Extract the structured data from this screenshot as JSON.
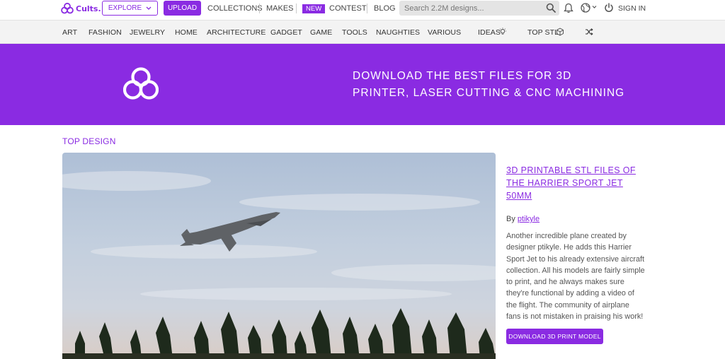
{
  "brand": {
    "name": "Cults.",
    "accent": "#8a2be2"
  },
  "topnav": {
    "explore_label": "EXPLORE",
    "upload_label": "UPLOAD",
    "collections_label": "COLLECTIONS",
    "makes_label": "MAKES",
    "new_badge": "NEW",
    "contest_label": "CONTEST",
    "blog_label": "BLOG",
    "search_placeholder": "Search 2.2M designs...",
    "signin_label": "SIGN IN"
  },
  "categories": {
    "art": "ART",
    "fashion": "FASHION",
    "jewelry": "JEWELRY",
    "home": "HOME",
    "architecture": "ARCHITECTURE",
    "gadget": "GADGET",
    "game": "GAME",
    "tools": "TOOLS",
    "naughties": "NAUGHTIES",
    "various": "VARIOUS",
    "ideas": "IDEAS",
    "top_stl": "TOP STL"
  },
  "hero": {
    "line1": "DOWNLOAD THE BEST FILES FOR 3D",
    "line2": "PRINTER, LASER CUTTING & CNC MACHINING"
  },
  "top_design": {
    "section_title": "TOP DESIGN",
    "article_title": "3D PRINTABLE STL FILES OF THE HARRIER SPORT JET 50MM",
    "by_prefix": "By ",
    "author": "ptikyle",
    "description": "Another incredible plane created by designer ptikyle. He adds this Harrier Sport Jet to his already extensive aircraft collection. All his models are fairly simple to print, and he always makes sure they're functional by adding a video of the flight. The community of airplane fans is not mistaken in praising his work!",
    "download_label": "DOWNLOAD 3D PRINT MODEL"
  }
}
